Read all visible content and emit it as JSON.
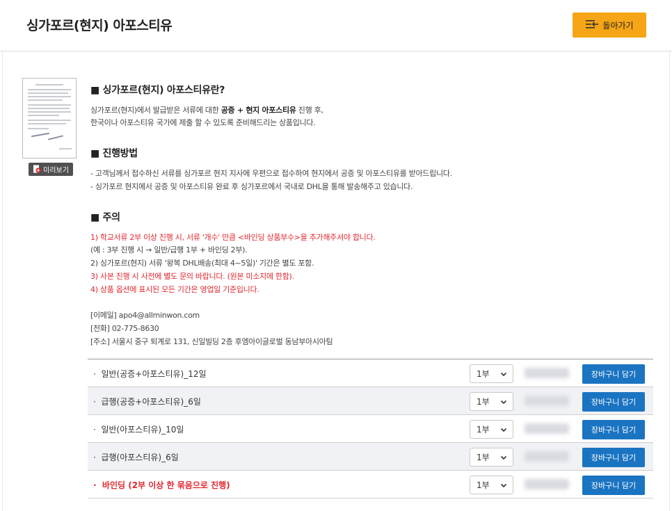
{
  "header": {
    "title": "싱가포르(현지) 아포스티유",
    "back_label": "돌아가기"
  },
  "preview_label": "미리보기",
  "intro": {
    "heading": "■ 싱가포르(현지) 아포스티유란?",
    "line1_a": "싱가포르(현지)에서 발급받은 서류에 대한 ",
    "line1_b": "공증 + 현지 아포스티유",
    "line1_c": " 진행 후,",
    "line2": "한국이나 아포스티유 국가에 제출 할 수 있도록 준비해드리는 상품입니다."
  },
  "process": {
    "heading": "■ 진행방법",
    "line1": "- 고객님께서 접수하신 서류를 싱가포르 현지 지사에 우편으로 접수하여 현지에서 공증 및 아포스티유를 받아드립니다.",
    "line2": "- 싱가포르 현지에서 공증 및 아포스티유 완료 후 싱가포르에서 국내로 DHL을 통해 발송해주고 있습니다."
  },
  "notice": {
    "heading": "■ 주의",
    "n1": "1) 학교서류 2부 이상 진행 시, 서류 '개수' 만큼 <바인딩 상품부수>을 추가해주셔야 합니다.",
    "n1_example": "(예 : 3부 진행 시 → 일반/급행 1부 + 바인딩 2부).",
    "n2": "2) 싱가포르(현지) 서류 '왕복 DHL배송(최대 4~5일)' 기간은 별도 포함.",
    "n3": "3) 사본 진행 시 사전에 별도 문의 바랍니다. (원본 미소지에 한함).",
    "n4": "4) 상품 옵션에 표시된 모든 기간은 영업일 기준입니다."
  },
  "contact": {
    "email": "[이메일] apo4@allminwon.com",
    "phone": "[전화] 02-775-8630",
    "address": "[주소] 서울시 중구 퇴계로 131, 신일빌딩 2층 후엠아이글로벌 동남부아시아팀"
  },
  "products": [
    {
      "name": "일반(공증+아포스티유)_12일",
      "qty": "1부",
      "cart": "장바구니 담기"
    },
    {
      "name": "급행(공증+아포스티유)_6일",
      "qty": "1부",
      "cart": "장바구니 담기"
    },
    {
      "name": "일반(아포스티유)_10일",
      "qty": "1부",
      "cart": "장바구니 담기"
    },
    {
      "name": "급행(아포스티유)_6일",
      "qty": "1부",
      "cart": "장바구니 담기"
    },
    {
      "name": "바인딩 (2부 이상 한 묶음으로 진행)",
      "qty": "1부",
      "cart": "장바구니 담기"
    }
  ],
  "colors": {
    "accent": "#f5a516",
    "cart_button": "#1a74c2",
    "warning": "#e0282f"
  }
}
